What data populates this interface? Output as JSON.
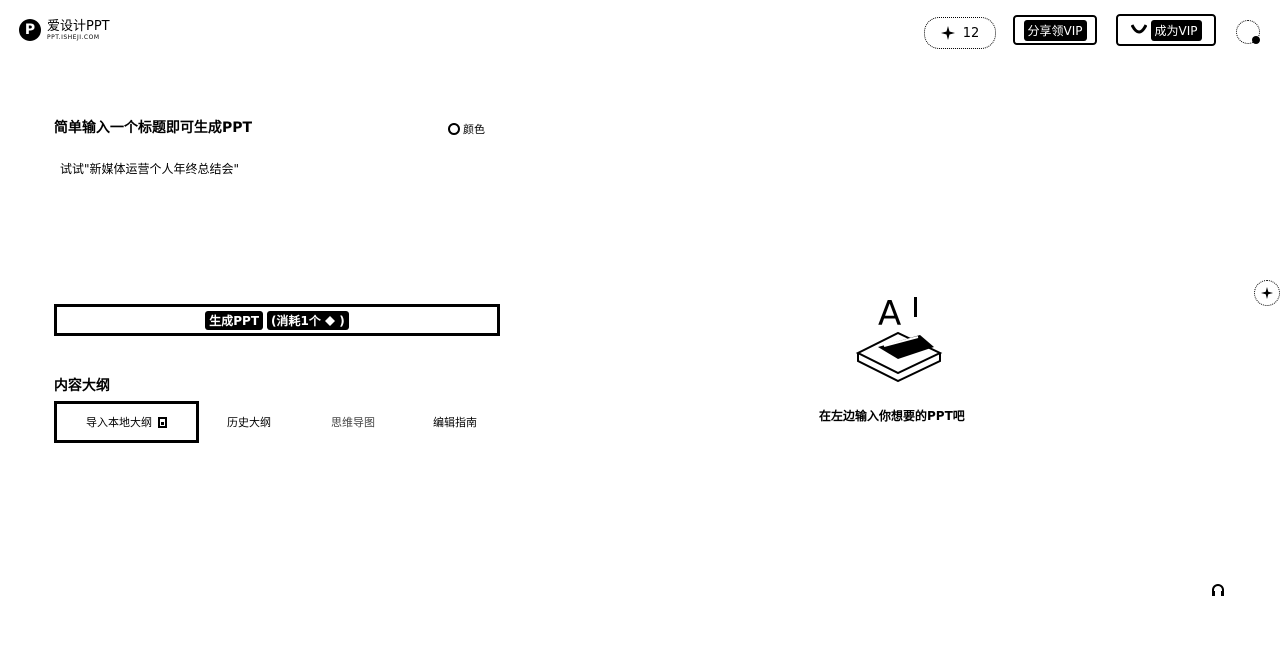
{
  "header": {
    "logo": {
      "name": "爱设计PPT",
      "sub": "PPT.ISHEJI.COM",
      "mark": "P"
    },
    "credits": {
      "icon": "sparkle-icon",
      "count": "12"
    },
    "share_vip_label": "分享领VIP",
    "become_vip_label": "成为VIP"
  },
  "input_panel": {
    "headline": "简单输入一个标题即可生成PPT",
    "color_label": "颜色",
    "example": "试试\"新媒体运营个人年终总结会\"",
    "generate": {
      "label": "生成PPT",
      "cost": "(消耗1个",
      "cost_end": ")"
    }
  },
  "outline": {
    "title": "内容大纲",
    "tabs": [
      {
        "label": "导入本地大纲"
      },
      {
        "label": "历史大纲"
      },
      {
        "label": "思维导图"
      },
      {
        "label": "编辑指南"
      }
    ]
  },
  "preview": {
    "hint": "在左边输入你想要的PPT吧",
    "illus_text": "A"
  },
  "colors": {
    "accent": "#000000",
    "background": "#ffffff"
  }
}
